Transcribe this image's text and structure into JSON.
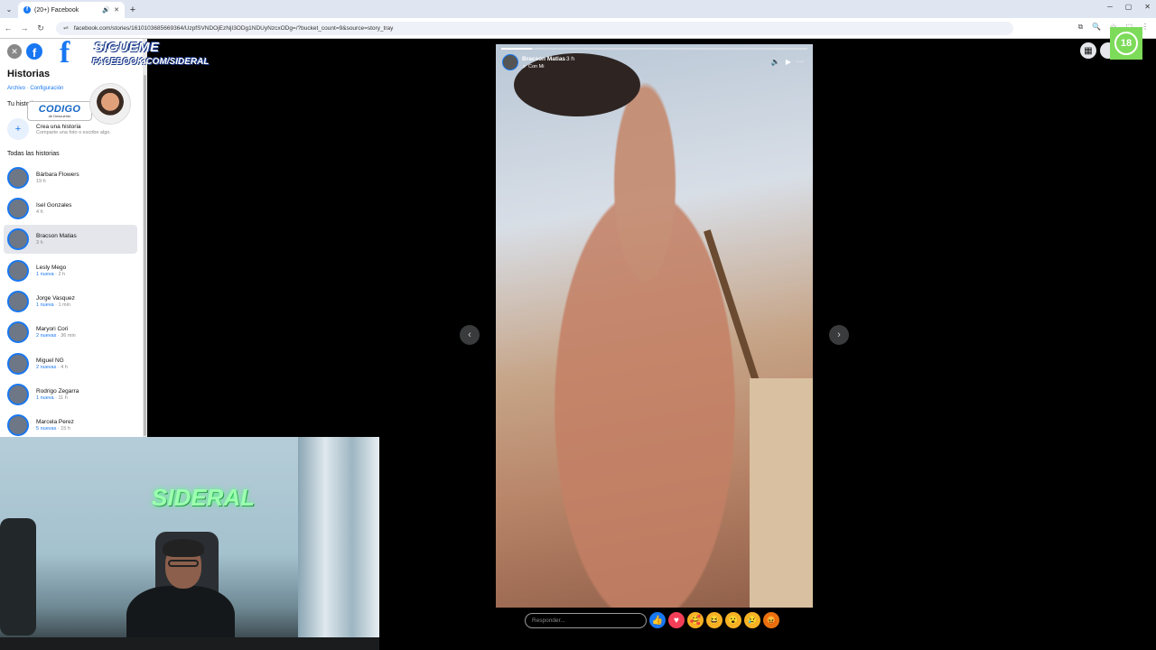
{
  "browser": {
    "tab_title": "(20+) Facebook",
    "fb_favicon": "f",
    "url": "facebook.com/stories/1610103685669364/UzpfSVNDOjEzNjI3ODg1NDUyNzcxODg=/?bucket_count=9&source=story_tray",
    "menu_icon": "⌄",
    "audio_icon": "🔊",
    "close_icon": "✕",
    "new_tab_icon": "+",
    "back_icon": "←",
    "forward_icon": "→",
    "reload_icon": "↻",
    "site_info_icon": "⇌",
    "toolbar_icons": [
      "⧉",
      "🔍",
      "☆",
      "⬚",
      "⋮"
    ],
    "window_controls": [
      "─",
      "▢",
      "✕"
    ]
  },
  "sidebar": {
    "close_icon": "✕",
    "fb_logo": "f",
    "heading": "Historias",
    "links": "Archivo · Configuración",
    "your_story_label": "Tu historia",
    "create": {
      "icon": "+",
      "title": "Crea una historia",
      "subtitle": "Comparte una foto o escribe algo."
    },
    "all_stories_label": "Todas las historias",
    "stories": [
      {
        "name": "Bárbara Flowers",
        "new": "",
        "time": "19 h"
      },
      {
        "name": "Isel Gonzales",
        "new": "",
        "time": "4 h"
      },
      {
        "name": "Bracson Matias",
        "new": "",
        "time": "3 h"
      },
      {
        "name": "Lesly Mego",
        "new": "1 nueva",
        "time": " · 2 h"
      },
      {
        "name": "Jorge Vasquez",
        "new": "1 nueva",
        "time": " · 1 min"
      },
      {
        "name": "Maryori Cori",
        "new": "2 nuevas",
        "time": " · 36 min"
      },
      {
        "name": "Miguel NG",
        "new": "2 nuevas",
        "time": " · 4 h"
      },
      {
        "name": "Rodrigo Zegarra",
        "new": "1 nueva",
        "time": " · 11 h"
      },
      {
        "name": "Marcela Perez",
        "new": "5 nuevas",
        "time": " · 15 h"
      }
    ]
  },
  "overlay": {
    "follow_line1": "SIGUEME",
    "follow_line2": "FACEBOOK.COM/SIDERAL",
    "code_title": "CODIGO",
    "code_sub": "de Descuento",
    "webcam_logo": "SIDERAL",
    "badge": "18"
  },
  "story_viewer": {
    "author": "Bracson Matias",
    "time": "3 h",
    "song": "♬ Con Mi",
    "progress_fraction": 0.1,
    "controls": [
      "🔈",
      "▶",
      "⋯"
    ],
    "prev_icon": "‹",
    "next_icon": "›",
    "reply_placeholder": "Responder...",
    "reactions": [
      {
        "icon": "👍",
        "color": "#1877f2"
      },
      {
        "icon": "♥",
        "color": "#f33e58"
      },
      {
        "icon": "🥰",
        "color": "#f7b125"
      },
      {
        "icon": "😆",
        "color": "#f7b125"
      },
      {
        "icon": "😮",
        "color": "#f7b125"
      },
      {
        "icon": "😢",
        "color": "#f7b125"
      },
      {
        "icon": "😡",
        "color": "#e9710f"
      }
    ]
  },
  "top_right": {
    "menu_icon": "▦"
  }
}
